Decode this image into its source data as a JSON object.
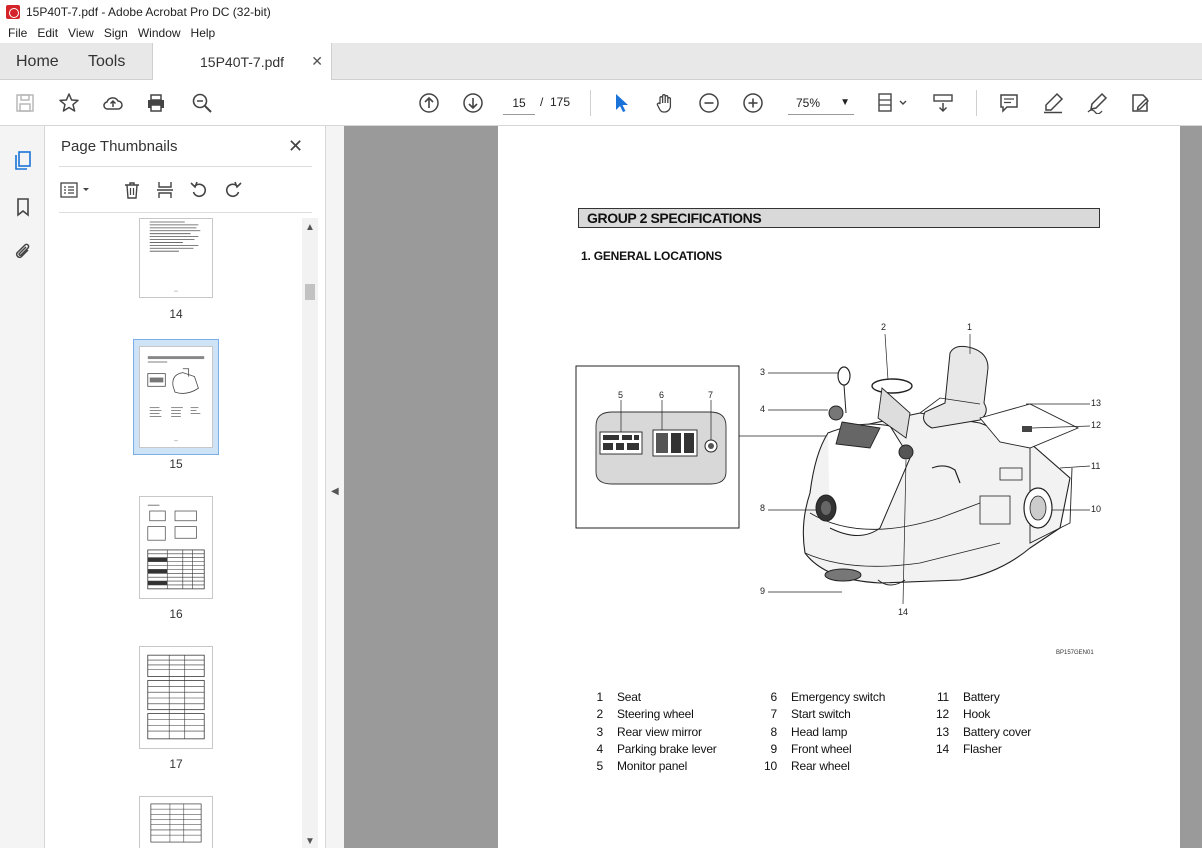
{
  "window": {
    "title": "15P40T-7.pdf - Adobe Acrobat Pro DC (32-bit)"
  },
  "menu": [
    "File",
    "Edit",
    "View",
    "Sign",
    "Window",
    "Help"
  ],
  "tabs": {
    "home": "Home",
    "tools": "Tools",
    "document": "15P40T-7.pdf"
  },
  "toolbar": {
    "current_page": "15",
    "page_separator": "/",
    "total_pages": "175",
    "zoom": "75%"
  },
  "thumbnails_panel": {
    "title": "Page Thumbnails",
    "pages": [
      {
        "label": "14"
      },
      {
        "label": "15",
        "selected": true
      },
      {
        "label": "16"
      },
      {
        "label": "17"
      }
    ]
  },
  "document": {
    "section_header": "GROUP 2  SPECIFICATIONS",
    "subheading": "1. GENERAL LOCATIONS",
    "figure_code": "BP157GEN01",
    "callouts": [
      "1",
      "2",
      "3",
      "4",
      "5",
      "6",
      "7",
      "8",
      "9",
      "10",
      "11",
      "12",
      "13",
      "14"
    ],
    "legend_columns": [
      [
        {
          "num": "1",
          "name": "Seat"
        },
        {
          "num": "2",
          "name": "Steering wheel"
        },
        {
          "num": "3",
          "name": "Rear view mirror"
        },
        {
          "num": "4",
          "name": "Parking brake lever"
        },
        {
          "num": "5",
          "name": "Monitor panel"
        }
      ],
      [
        {
          "num": "6",
          "name": "Emergency switch"
        },
        {
          "num": "7",
          "name": "Start switch"
        },
        {
          "num": "8",
          "name": "Head lamp"
        },
        {
          "num": "9",
          "name": "Front wheel"
        },
        {
          "num": "10",
          "name": "Rear wheel"
        }
      ],
      [
        {
          "num": "11",
          "name": "Battery"
        },
        {
          "num": "12",
          "name": "Hook"
        },
        {
          "num": "13",
          "name": "Battery cover"
        },
        {
          "num": "14",
          "name": "Flasher"
        }
      ]
    ]
  }
}
